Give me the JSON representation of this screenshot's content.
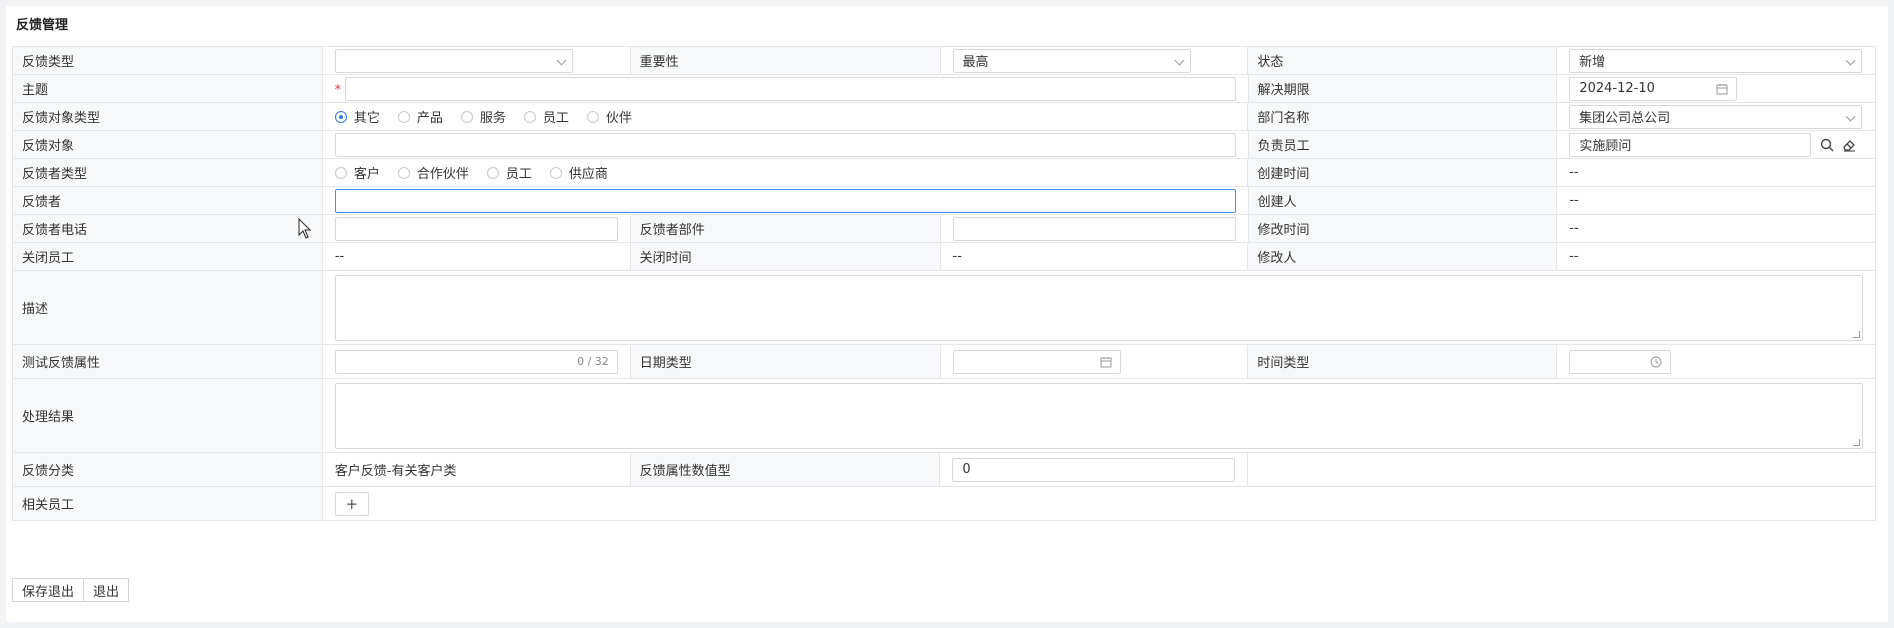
{
  "page": {
    "title": "反馈管理"
  },
  "form": {
    "feedback_type": {
      "label": "反馈类型",
      "value": ""
    },
    "importance": {
      "label": "重要性",
      "value": "最高"
    },
    "status": {
      "label": "状态",
      "value": "新增"
    },
    "subject": {
      "label": "主题",
      "required_mark": "*",
      "value": ""
    },
    "deadline": {
      "label": "解决期限",
      "value": "2024-12-10"
    },
    "target_type": {
      "label": "反馈对象类型",
      "options": [
        "其它",
        "产品",
        "服务",
        "员工",
        "伙伴"
      ],
      "selected": "其它"
    },
    "department": {
      "label": "部门名称",
      "value": "集团公司总公司"
    },
    "target": {
      "label": "反馈对象",
      "value": ""
    },
    "owner": {
      "label": "负责员工",
      "value": "实施顾问"
    },
    "reporter_type": {
      "label": "反馈者类型",
      "options": [
        "客户",
        "合作伙伴",
        "员工",
        "供应商"
      ],
      "selected": ""
    },
    "created_time": {
      "label": "创建时间",
      "value": "--"
    },
    "reporter": {
      "label": "反馈者",
      "value": ""
    },
    "creator": {
      "label": "创建人",
      "value": "--"
    },
    "reporter_phone": {
      "label": "反馈者电话",
      "value": ""
    },
    "reporter_dept": {
      "label": "反馈者部件",
      "value": ""
    },
    "modified_time": {
      "label": "修改时间",
      "value": "--"
    },
    "closer": {
      "label": "关闭员工",
      "value": "--"
    },
    "closed_time": {
      "label": "关闭时间",
      "value": "--"
    },
    "modifier": {
      "label": "修改人",
      "value": "--"
    },
    "description": {
      "label": "描述",
      "value": ""
    },
    "test_attr": {
      "label": "测试反馈属性",
      "value": "",
      "counter": "0 / 32"
    },
    "date_type": {
      "label": "日期类型",
      "value": ""
    },
    "time_type": {
      "label": "时间类型",
      "value": ""
    },
    "result": {
      "label": "处理结果",
      "value": ""
    },
    "category": {
      "label": "反馈分类",
      "value": "客户反馈-有关客户类"
    },
    "numeric_attr": {
      "label": "反馈属性数值型",
      "value": "0"
    },
    "related_staff": {
      "label": "相关员工",
      "add_label": "+"
    }
  },
  "buttons": {
    "save_exit": "保存退出",
    "exit": "退出"
  },
  "icons": [
    "chevron-down-icon",
    "calendar-icon",
    "clock-icon",
    "search-icon",
    "eraser-icon",
    "plus-icon",
    "mouse-cursor-icon"
  ],
  "colors": {
    "accent": "#2e7be6",
    "required": "#e53935",
    "label_bg": "#f7f8fa",
    "border": "#e4e6eb"
  }
}
